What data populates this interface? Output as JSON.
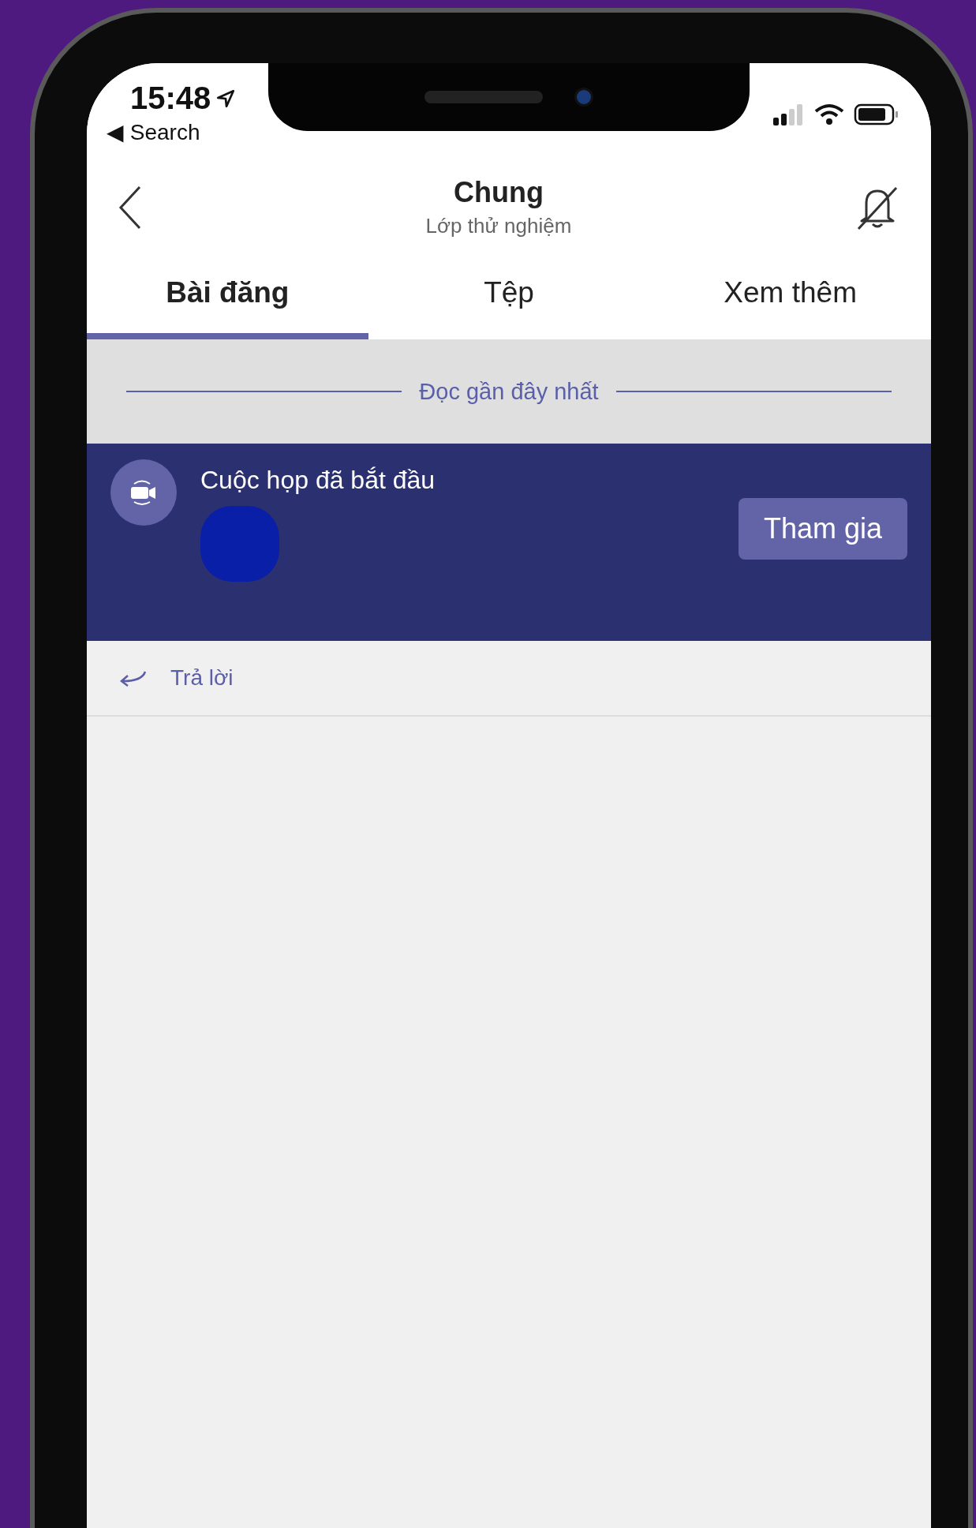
{
  "status_bar": {
    "time": "15:48",
    "back_link": "◀ Search"
  },
  "header": {
    "title": "Chung",
    "subtitle": "Lớp thử nghiệm"
  },
  "tabs": [
    {
      "label": "Bài đăng",
      "selected": true
    },
    {
      "label": "Tệp",
      "selected": false
    },
    {
      "label": "Xem thêm",
      "selected": false
    }
  ],
  "divider_label": "Đọc gần đây nhất",
  "meeting_card": {
    "title": "Cuộc họp đã bắt đầu",
    "button": "Tham gia"
  },
  "reply": {
    "label": "Trả lời"
  }
}
